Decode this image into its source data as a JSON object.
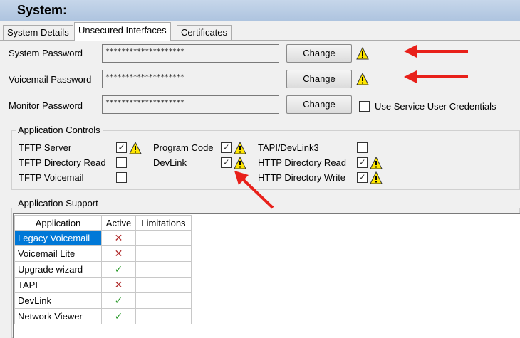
{
  "header": {
    "title": "System:"
  },
  "tabs": [
    {
      "label": "System Details"
    },
    {
      "label": "Unsecured Interfaces",
      "active": true
    },
    {
      "label": "Certificates"
    }
  ],
  "passwords": {
    "system": {
      "label": "System Password",
      "value": "********************",
      "button": "Change",
      "warning": true
    },
    "voicemail": {
      "label": "Voicemail Password",
      "value": "********************",
      "button": "Change",
      "warning": true
    },
    "monitor": {
      "label": "Monitor Password",
      "value": "********************",
      "button": "Change",
      "warning": false
    }
  },
  "use_service_user": {
    "label": "Use Service User Credentials",
    "checked": false
  },
  "app_controls": {
    "title": "Application Controls",
    "items": [
      {
        "label": "TFTP Server",
        "checked": true,
        "warning": true
      },
      {
        "label": "TFTP Directory Read",
        "checked": false,
        "warning": false
      },
      {
        "label": "TFTP Voicemail",
        "checked": false,
        "warning": false
      },
      {
        "label": "Program Code",
        "checked": true,
        "warning": true
      },
      {
        "label": "DevLink",
        "checked": true,
        "warning": true
      },
      {
        "label": "TAPI/DevLink3",
        "checked": false,
        "warning": false
      },
      {
        "label": "HTTP Directory Read",
        "checked": true,
        "warning": true
      },
      {
        "label": "HTTP Directory Write",
        "checked": true,
        "warning": true
      }
    ]
  },
  "app_support": {
    "title": "Application Support",
    "columns": [
      "Application",
      "Active",
      "Limitations"
    ],
    "rows": [
      {
        "application": "Legacy Voicemail",
        "active": false,
        "limitations": ""
      },
      {
        "application": "Voicemail Lite",
        "active": false,
        "limitations": ""
      },
      {
        "application": "Upgrade wizard",
        "active": true,
        "limitations": ""
      },
      {
        "application": "TAPI",
        "active": false,
        "limitations": ""
      },
      {
        "application": "DevLink",
        "active": true,
        "limitations": ""
      },
      {
        "application": "Network Viewer",
        "active": true,
        "limitations": ""
      }
    ]
  },
  "colors": {
    "header_bg": "#b8cbe4",
    "selection": "#0078d7",
    "warning_yellow": "#ffe600",
    "annotation_arrow": "#e8201a",
    "active_check": "#2a9a2a",
    "inactive_x": "#b02a2a"
  },
  "marks": {
    "check": "✓",
    "cross": "✕",
    "checked_box": "✓"
  }
}
